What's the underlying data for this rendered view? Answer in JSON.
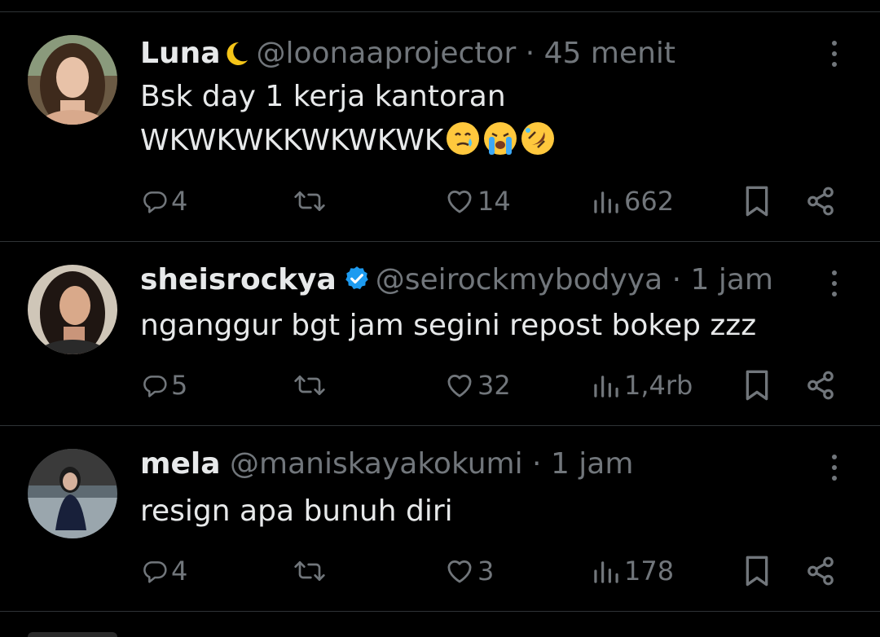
{
  "colors": {
    "background": "#000000",
    "text": "#e7e9ea",
    "muted": "#71767b",
    "divider": "#2f3336",
    "verified": "#1d9bf0"
  },
  "tweets": [
    {
      "name": "Luna",
      "name_emoji": "crescent-moon-icon",
      "verified": false,
      "handle": "@loonaaprojector",
      "separator": "·",
      "time": "45 menit",
      "text_line1": "Bsk day 1 kerja kantoran",
      "text_line2": "WKWKWKKWKWKWK",
      "text_emojis": [
        "face-holding-back-tears-icon",
        "loudly-crying-face-icon",
        "rolling-laughing-face-icon"
      ],
      "replies": "4",
      "reposts": "",
      "likes": "14",
      "views": "662"
    },
    {
      "name": "sheisrockya",
      "verified": true,
      "handle": "@seirockmybodyya",
      "separator": "·",
      "time": "1 jam",
      "text_line1": "nganggur bgt jam segini repost bokep zzz",
      "replies": "5",
      "reposts": "",
      "likes": "32",
      "views": "1,4rb"
    },
    {
      "name": "mela",
      "verified": false,
      "handle": "@maniskayakokumi",
      "separator": "·",
      "time": "1 jam",
      "text_line1": "resign apa bunuh diri",
      "replies": "4",
      "reposts": "",
      "likes": "3",
      "views": "178"
    }
  ]
}
